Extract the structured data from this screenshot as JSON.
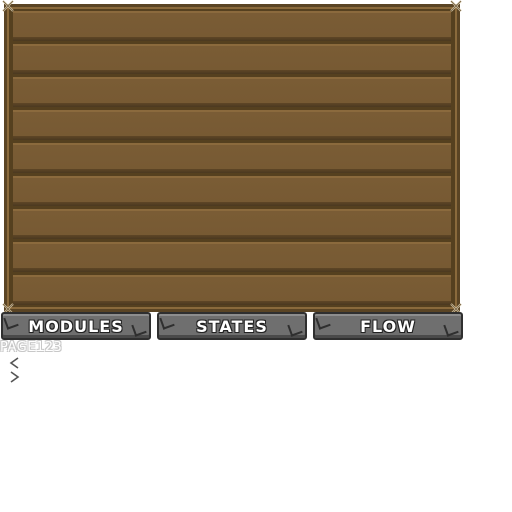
{
  "tabs": [
    {
      "label": "MODULES"
    },
    {
      "label": "STATES"
    },
    {
      "label": "FLOW"
    }
  ],
  "page_indicator": "PAGE123",
  "colors": {
    "board_wood": "#775a33",
    "board_frame": "#5a4424",
    "tab_stone": "#6f6f6f",
    "tab_text": "#ffffff"
  },
  "icons": {
    "corners": "cross-rivet-icon",
    "prev": "chevron-left-icon",
    "next": "chevron-right-icon"
  }
}
